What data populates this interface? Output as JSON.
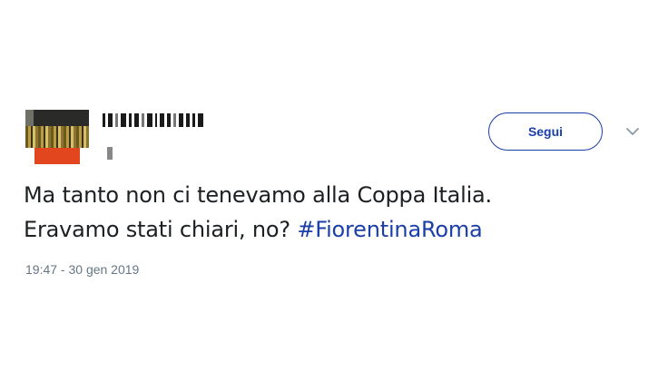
{
  "tweet": {
    "follow_label": "Segui",
    "text_line1": "Ma tanto non ci tenevamo alla Coppa Italia.",
    "text_line2_prefix": "Eravamo stati chiari, no? ",
    "hashtag": "#FiorentinaRoma",
    "timestamp": "19:47 - 30 gen 2019",
    "menu_icon": "chevron-down-icon"
  },
  "colors": {
    "accent": "#1b3fa8",
    "text": "#1c2022",
    "muted": "#657786"
  }
}
